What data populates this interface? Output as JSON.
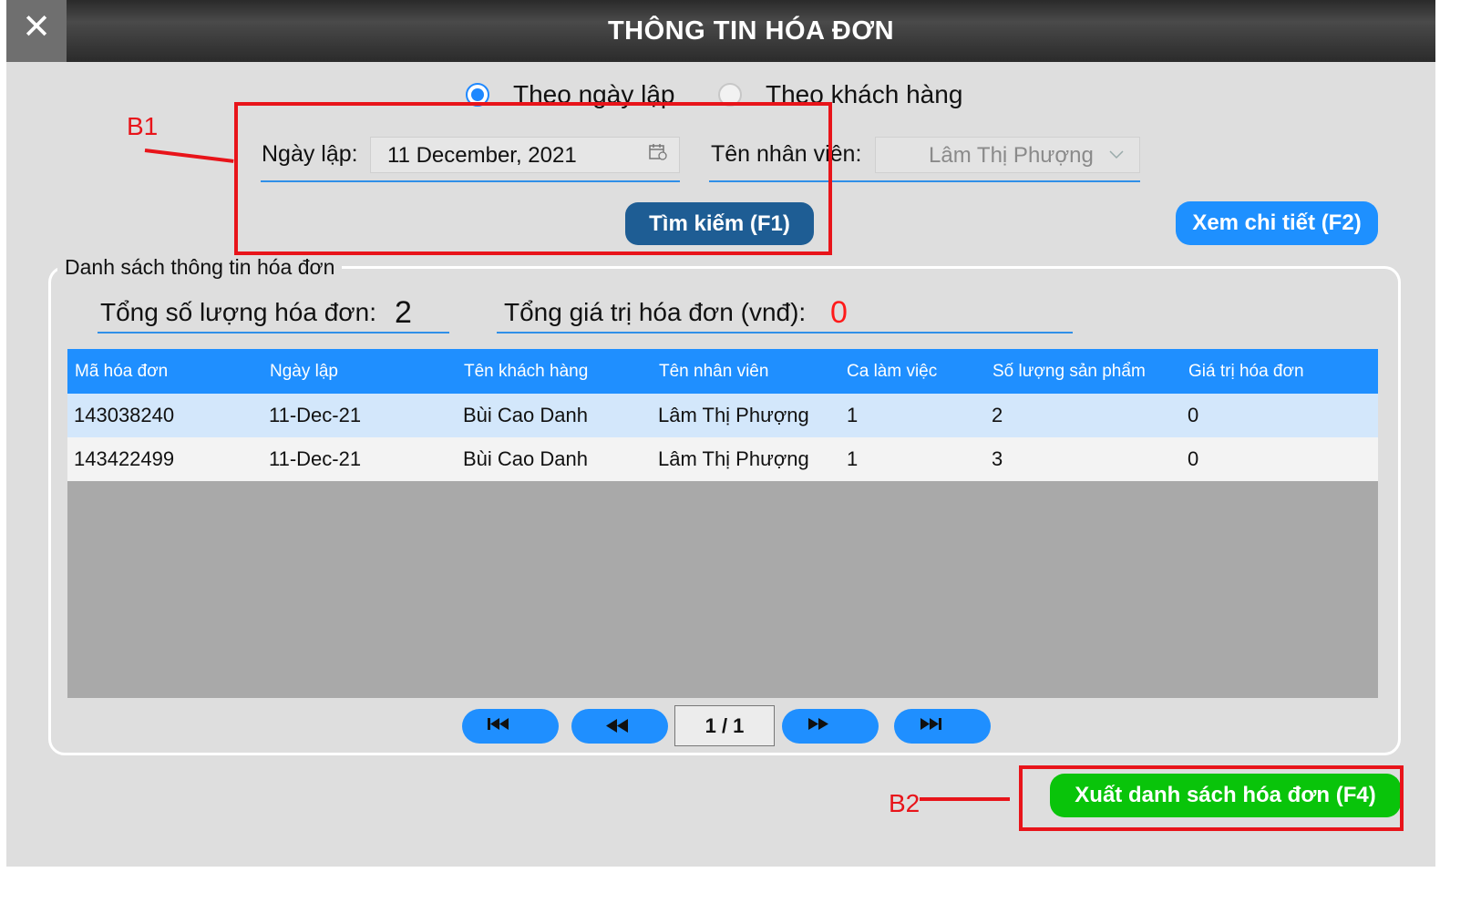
{
  "window": {
    "title": "THÔNG TIN HÓA ĐƠN",
    "close_glyph": "✕"
  },
  "filter_mode": {
    "options": [
      {
        "label": "Theo ngày lập",
        "selected": true
      },
      {
        "label": "Theo khách hàng",
        "selected": false
      }
    ]
  },
  "search": {
    "date_label": "Ngày lập:",
    "date_value": "11 December, 2021",
    "employee_label": "Tên nhân viên:",
    "employee_value": "Lâm Thị Phượng",
    "search_button": "Tìm kiếm (F1)",
    "detail_button": "Xem chi tiết (F2)"
  },
  "annotations": {
    "b1": "B1",
    "b2": "B2",
    "color": "#e8141a"
  },
  "invoice_list": {
    "group_title": "Danh sách thông tin hóa đơn",
    "total_count_label": "Tổng số lượng hóa đơn:",
    "total_count": "2",
    "total_value_label": "Tổng giá trị hóa đơn (vnđ):",
    "total_value": "0",
    "columns": [
      "Mã hóa đơn",
      "Ngày lập",
      "Tên khách hàng",
      "Tên nhân viên",
      "Ca làm việc",
      "Số lượng sản phẩm",
      "Giá trị hóa đơn"
    ],
    "rows": [
      [
        "143038240",
        "11-Dec-21",
        "Bùi Cao Danh",
        "Lâm Thị Phượng",
        "1",
        "2",
        "0"
      ],
      [
        "143422499",
        "11-Dec-21",
        "Bùi Cao Danh",
        "Lâm Thị Phượng",
        "1",
        "3",
        "0"
      ]
    ]
  },
  "pagination": {
    "page_indicator": "1 / 1"
  },
  "export_button": "Xuất danh sách hóa đơn (F4)",
  "colors": {
    "accent": "#1f8fff",
    "dark_button": "#1e5d94",
    "export_button": "#09c40a",
    "total_value": "#ff1a1a"
  }
}
